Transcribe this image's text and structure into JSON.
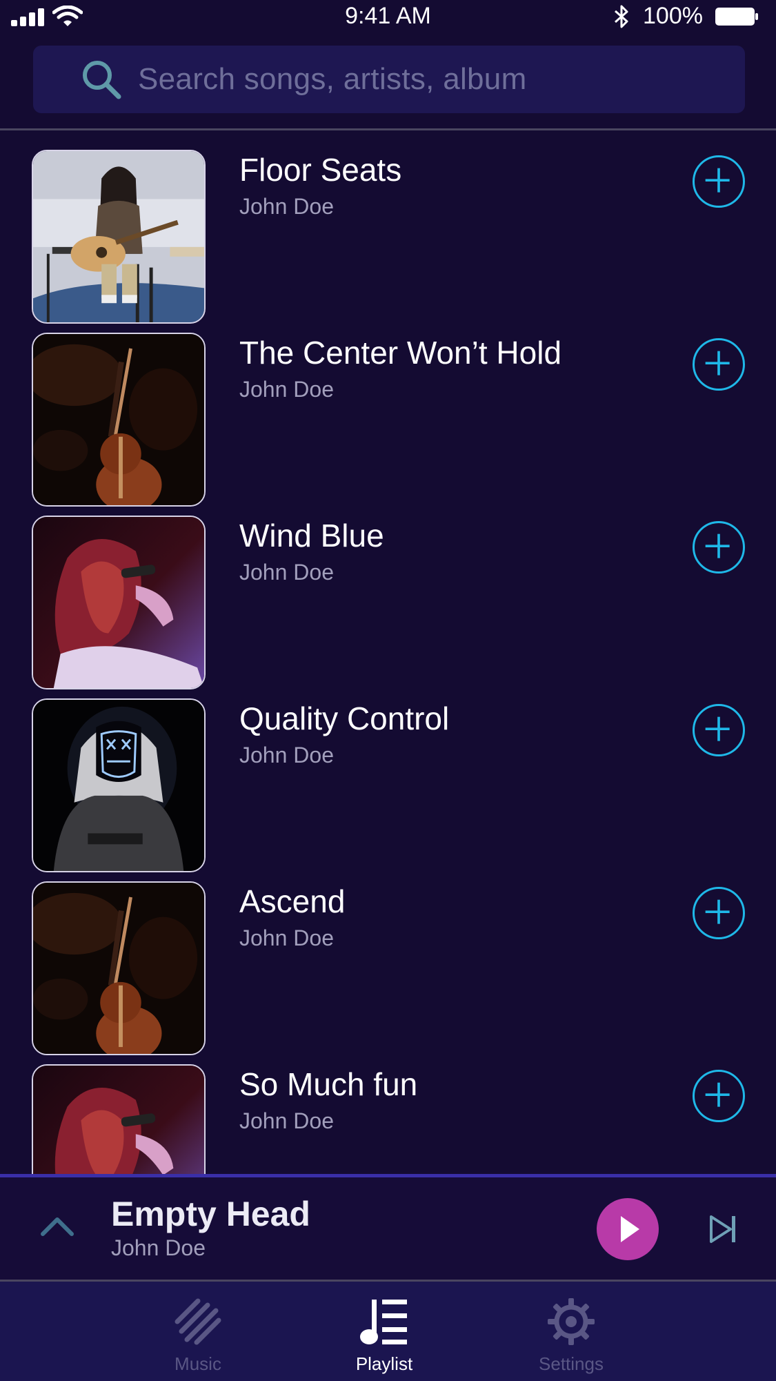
{
  "status_bar": {
    "time": "9:41 AM",
    "battery": "100%",
    "icons": [
      "signal-icon",
      "wifi-icon",
      "bluetooth-icon",
      "battery-icon"
    ]
  },
  "search": {
    "placeholder": "Search songs, artists, album",
    "icon": "search-icon"
  },
  "songs": [
    {
      "title": "Floor Seats",
      "artist": "John Doe",
      "art": "girl-with-guitar"
    },
    {
      "title": "The Center Won’t Hold",
      "artist": "John Doe",
      "art": "violin-dark"
    },
    {
      "title": "Wind Blue",
      "artist": "John Doe",
      "art": "singer-red-hair"
    },
    {
      "title": "Quality Control",
      "artist": "John Doe",
      "art": "neon-mask-hoodie"
    },
    {
      "title": "Ascend",
      "artist": "John Doe",
      "art": "violin-dark"
    },
    {
      "title": "So Much fun",
      "artist": "John Doe",
      "art": "singer-red-hair"
    }
  ],
  "now_playing": {
    "title": "Empty Head",
    "artist": "John Doe"
  },
  "tabs": [
    {
      "label": "Music",
      "icon": "music-icon",
      "active": false
    },
    {
      "label": "Playlist",
      "icon": "playlist-icon",
      "active": true
    },
    {
      "label": "Settings",
      "icon": "settings-icon",
      "active": false
    }
  ],
  "colors": {
    "background": "#140b32",
    "accent": "#1fb8e8",
    "play_button": "#b83aa8",
    "tab_bar": "#1b1550",
    "inactive_tab": "#5a5785"
  }
}
